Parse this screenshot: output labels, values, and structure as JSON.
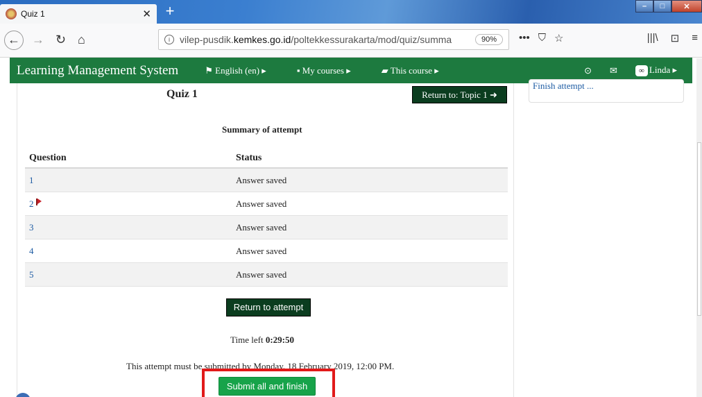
{
  "browser": {
    "tab_title": "Quiz 1",
    "tab_close": "✕",
    "new_tab": "+",
    "url_domain_prefix": "vilep-pusdik.",
    "url_domain_bold": "kemkes.go.id",
    "url_path": "/poltekkessurakarta/mod/quiz/summa",
    "zoom": "90%",
    "page_actions": [
      "•••",
      "⛉",
      "☆"
    ],
    "tools": [
      "|||\\",
      "⊡",
      "≡"
    ]
  },
  "header": {
    "brand": "Learning Management System",
    "menu": [
      {
        "icon": "⚑",
        "label": "English (en) ▸"
      },
      {
        "icon": "▪",
        "label": "My courses ▸"
      },
      {
        "icon": "▰",
        "label": "This course ▸"
      }
    ],
    "user": "Linda ▸"
  },
  "main": {
    "quiz_title": "Quiz 1",
    "return_topic": "Return to: Topic 1 ➜",
    "summary_heading": "Summary of attempt",
    "columns": [
      "Question",
      "Status"
    ],
    "rows": [
      {
        "question": "1",
        "status": "Answer saved",
        "flagged": false
      },
      {
        "question": "2",
        "status": "Answer saved",
        "flagged": true
      },
      {
        "question": "3",
        "status": "Answer saved",
        "flagged": false
      },
      {
        "question": "4",
        "status": "Answer saved",
        "flagged": false
      },
      {
        "question": "5",
        "status": "Answer saved",
        "flagged": false
      }
    ],
    "return_attempt": "Return to attempt",
    "time_left_label": "Time left",
    "time_left_value": "0:29:50",
    "deadline": "This attempt must be submitted by Monday, 18 February 2019, 12:00 PM.",
    "submit": "Submit all and finish"
  },
  "sidebar": {
    "finish_link": "Finish attempt ..."
  },
  "colors": {
    "header_green": "#1d7a3f",
    "dark_button": "#0b3d1f",
    "submit_green": "#17a34a",
    "highlight_red": "#e11a1a",
    "link_blue": "#1d5ba3"
  }
}
